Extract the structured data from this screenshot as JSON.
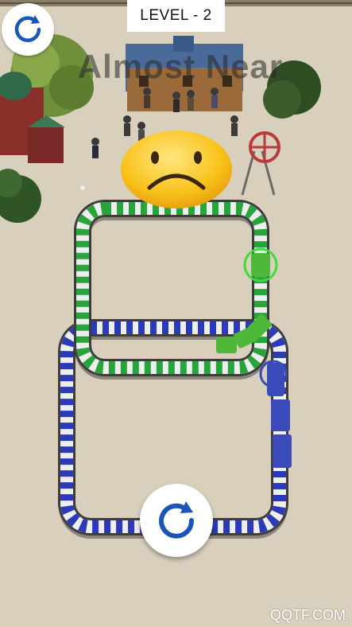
{
  "hud": {
    "level_label": "LEVEL - 2",
    "status_message": "Almost Near",
    "restart_icon": "restart-icon",
    "big_restart_icon": "restart-icon"
  },
  "feedback": {
    "emoji": "sad-face-emoji"
  },
  "tracks": {
    "green_loop_color": "#27a53a",
    "blue_loop_color": "#2b3ab8",
    "track_base_color": "#3d3d3d"
  },
  "trains": {
    "green_train_color": "#4fb83a",
    "blue_train_color": "#3a4ab8",
    "highlight_ring_color": "#3ddc3a"
  },
  "watermark": "QQTF.COM",
  "colors": {
    "ground": "#d8d0bc",
    "accent_blue": "#1a56b8"
  }
}
